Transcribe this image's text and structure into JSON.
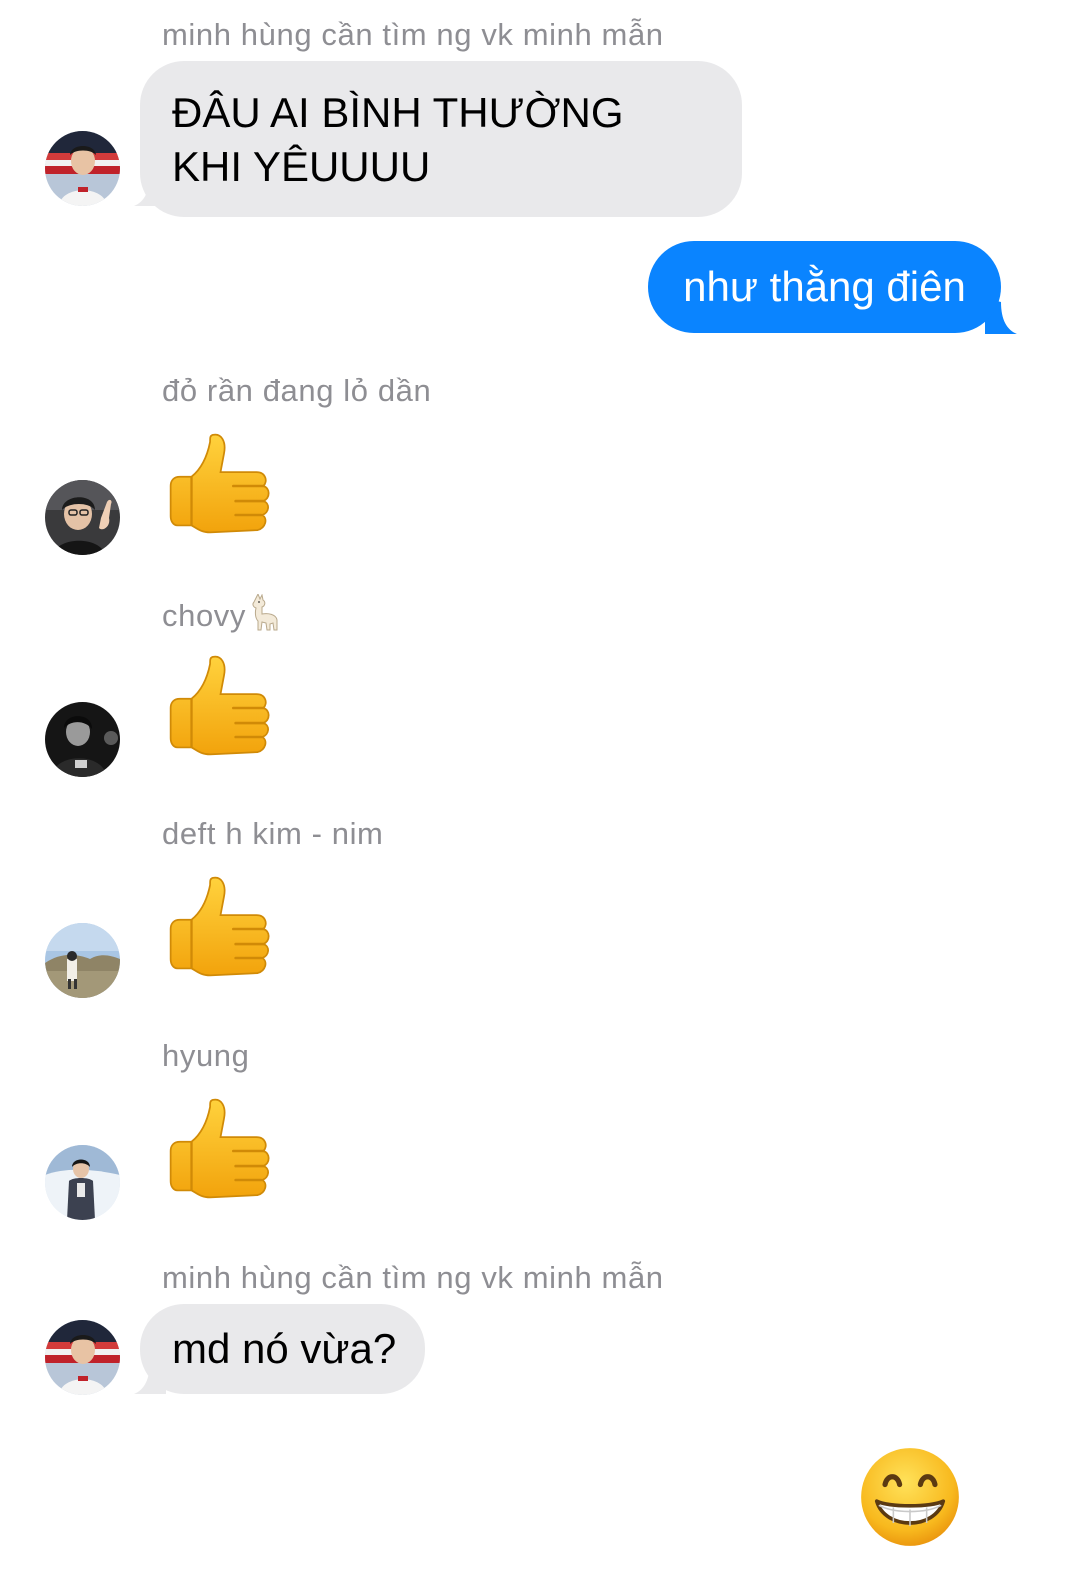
{
  "messages": [
    {
      "sender": "minh hùng cần tìm ng vk minh mẫn",
      "text": "ĐÂU AI BÌNH THƯỜNG KHI YÊUUUU"
    },
    {
      "sender": "me",
      "text": "như thằng điên"
    },
    {
      "sender": "đỏ rần đang lỏ dần",
      "reaction": "thumbs-up-emoji"
    },
    {
      "sender": "chovy",
      "sender_emoji": "llama-emoji",
      "reaction": "thumbs-up-emoji"
    },
    {
      "sender": "deft h kim - nim",
      "reaction": "thumbs-up-emoji"
    },
    {
      "sender": "hyung",
      "reaction": "thumbs-up-emoji"
    },
    {
      "sender": "minh hùng cần tìm ng vk minh mẫn",
      "text": "md nó vừa?"
    },
    {
      "sender": "me",
      "reaction": "grinning-face-emoji"
    }
  ],
  "colors": {
    "outgoing_bubble": "#0a84ff",
    "incoming_bubble": "#e9e9eb",
    "sender_name": "#8e8e93",
    "background": "#ffffff"
  }
}
